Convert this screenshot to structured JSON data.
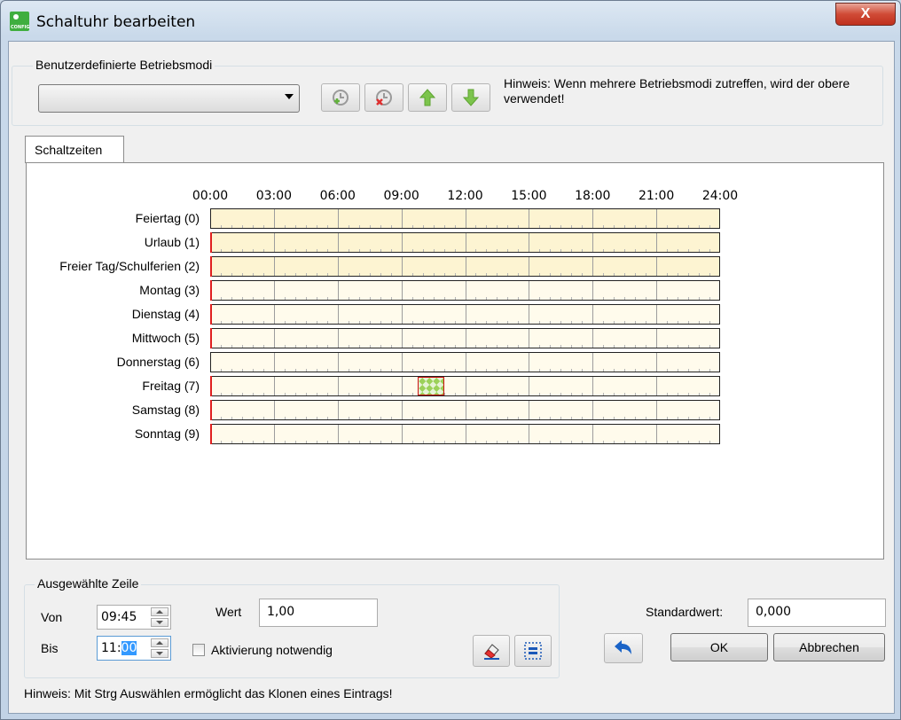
{
  "window": {
    "title": "Schaltuhr bearbeiten",
    "close_label": "X",
    "icon_text": "CONFIG"
  },
  "modes_group": {
    "legend": "Benutzerdefinierte Betriebsmodi",
    "combo_value": "",
    "hint": "Hinweis: Wenn mehrere Betriebsmodi zutreffen, wird der obere verwendet!"
  },
  "tab": {
    "label": "Schaltzeiten"
  },
  "schedule": {
    "time_labels": [
      "00:00",
      "03:00",
      "06:00",
      "09:00",
      "12:00",
      "15:00",
      "18:00",
      "21:00",
      "24:00"
    ],
    "days": [
      {
        "label": "Feiertag (0)",
        "highlighted": true,
        "red_marker": false
      },
      {
        "label": "Urlaub (1)",
        "highlighted": true,
        "red_marker": true
      },
      {
        "label": "Freier Tag/Schulferien (2)",
        "highlighted": true,
        "red_marker": true
      },
      {
        "label": "Montag (3)",
        "highlighted": false,
        "red_marker": true
      },
      {
        "label": "Dienstag (4)",
        "highlighted": false,
        "red_marker": true
      },
      {
        "label": "Mittwoch (5)",
        "highlighted": false,
        "red_marker": true
      },
      {
        "label": "Donnerstag (6)",
        "highlighted": false,
        "red_marker": false
      },
      {
        "label": "Freitag (7)",
        "highlighted": false,
        "red_marker": true
      },
      {
        "label": "Samstag (8)",
        "highlighted": false,
        "red_marker": true
      },
      {
        "label": "Sonntag (9)",
        "highlighted": false,
        "red_marker": true
      }
    ],
    "segments": [
      {
        "day_index": 7,
        "start_hour": 9.75,
        "end_hour": 11.0
      }
    ],
    "colors": {
      "highlighted_bg": "#fdf4d2",
      "normal_bg": "#fffbec",
      "segment": "#9cd15a",
      "marker": "#e02020"
    }
  },
  "selected_row": {
    "legend": "Ausgewählte Zeile",
    "von_label": "Von",
    "von_value": "09:45",
    "bis_label": "Bis",
    "bis_value_prefix": "11:",
    "bis_value_selected": "00",
    "wert_label": "Wert",
    "wert_value": "1,00",
    "activation_label": "Aktivierung notwendig"
  },
  "standard": {
    "label": "Standardwert:",
    "value": "0,000"
  },
  "buttons": {
    "ok": "OK",
    "cancel": "Abbrechen"
  },
  "footer_hint": "Hinweis: Mit Strg Auswählen ermöglicht das Klonen eines Eintrags!"
}
